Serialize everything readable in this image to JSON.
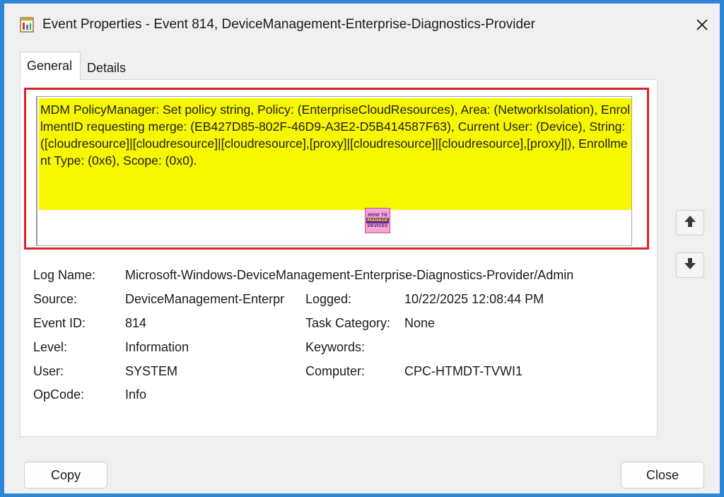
{
  "window": {
    "title": "Event Properties - Event 814, DeviceManagement-Enterprise-Diagnostics-Provider"
  },
  "icons": {
    "app": "event-viewer-icon",
    "close": "close-icon",
    "up": "arrow-up-icon",
    "down": "arrow-down-icon",
    "logo": "how-to-manage-devices-logo"
  },
  "tabs": [
    {
      "label": "General",
      "active": true
    },
    {
      "label": "Details",
      "active": false
    }
  ],
  "message": {
    "text": "MDM PolicyManager: Set policy string, Policy: (EnterpriseCloudResources), Area: (NetworkIsolation), EnrollmentID requesting merge: (EB427D85-802F-46D9-A3E2-D5B414587F63), Current User: (Device), String: ([cloudresource]|[cloudresource]|[cloudresource],[proxy]|[cloudresource]|[cloudresource],[proxy]|), Enrollment Type: (0x6), Scope: (0x0).",
    "highlight_color": "#f7f700",
    "frame_color": "#e0202a"
  },
  "logo": {
    "line1": "HOW TO",
    "line2": "MANAGE",
    "line3": "DEVICES"
  },
  "fields": {
    "log_name": {
      "label": "Log Name:",
      "value": "Microsoft-Windows-DeviceManagement-Enterprise-Diagnostics-Provider/Admin"
    },
    "source": {
      "label": "Source:",
      "value": "DeviceManagement-Enterpr"
    },
    "logged": {
      "label": "Logged:",
      "value": "10/22/2025 12:08:44 PM"
    },
    "event_id": {
      "label": "Event ID:",
      "value": "814"
    },
    "task_category": {
      "label": "Task Category:",
      "value": "None"
    },
    "level": {
      "label": "Level:",
      "value": "Information"
    },
    "keywords": {
      "label": "Keywords:",
      "value": ""
    },
    "user": {
      "label": "User:",
      "value": "SYSTEM"
    },
    "computer": {
      "label": "Computer:",
      "value": "CPC-HTMDT-TVWI1"
    },
    "opcode": {
      "label": "OpCode:",
      "value": "Info"
    }
  },
  "buttons": {
    "copy": "Copy",
    "close": "Close"
  },
  "colors": {
    "background": "#2e86d8",
    "window": "#f0f0f0"
  }
}
